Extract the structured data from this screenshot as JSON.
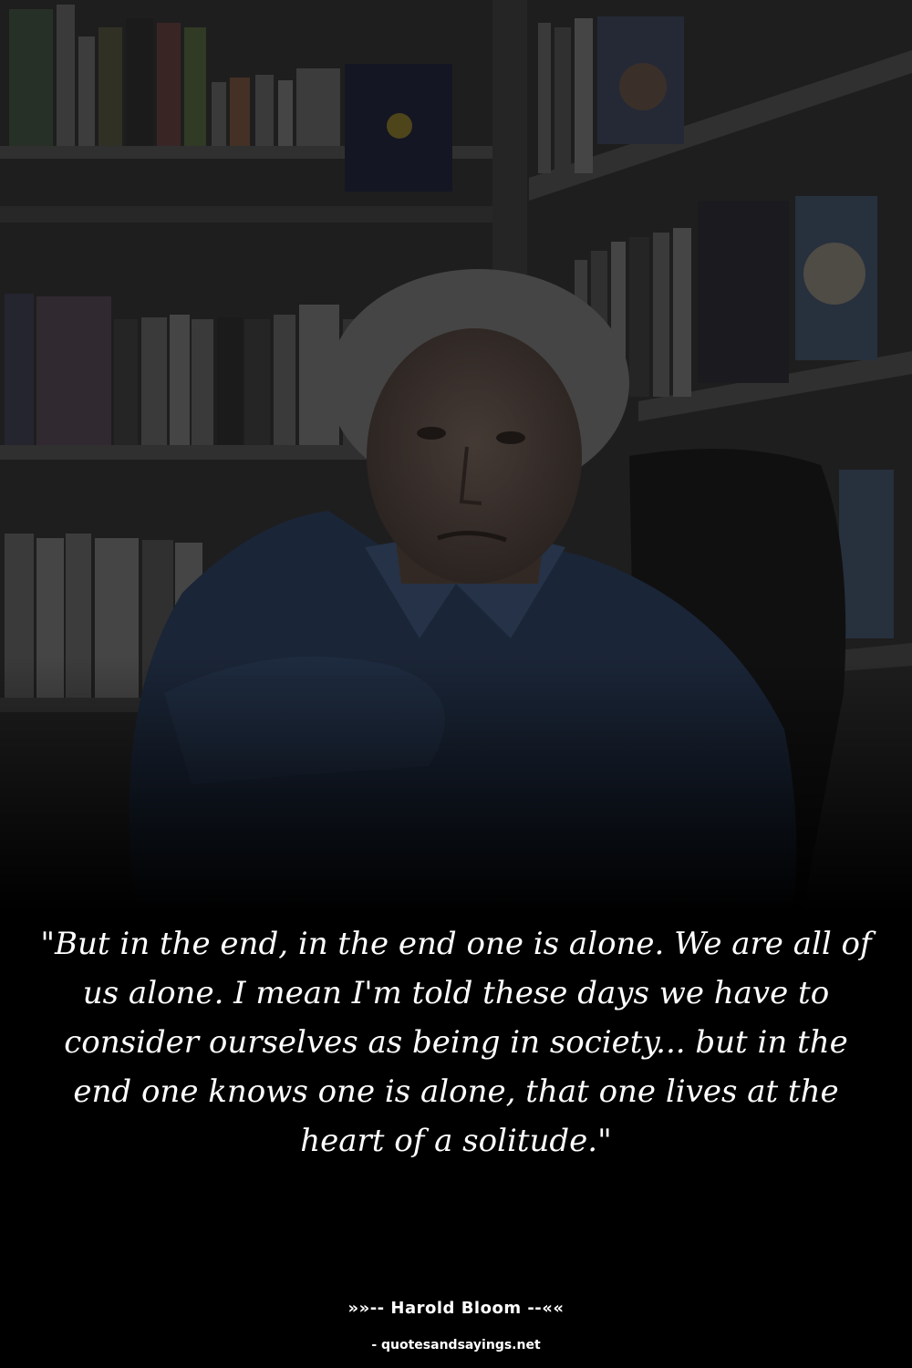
{
  "photo": {
    "subject": "man-in-blue-shirt-in-front-of-bookshelves",
    "overlay_color": "#000000"
  },
  "quote": {
    "text": "\"But in the end, in the end one is alone. We are all of us alone. I mean I'm told these days we have to consider ourselves as being in society... but in the end one knows one is alone, that one lives at the heart of a solitude.\""
  },
  "attribution": {
    "author_line": "»»-- Harold Bloom --««",
    "source": "- quotesandsayings.net"
  },
  "colors": {
    "background": "#000000",
    "text": "#ffffff"
  }
}
